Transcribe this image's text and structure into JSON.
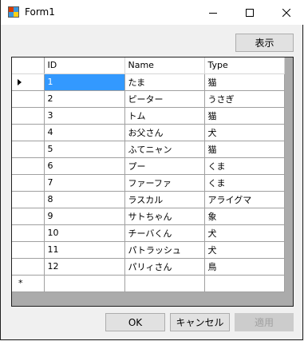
{
  "window": {
    "title": "Form1"
  },
  "toolbar": {
    "show_label": "表示"
  },
  "grid": {
    "columns": [
      "ID",
      "Name",
      "Type"
    ],
    "rows": [
      {
        "id": "1",
        "name": "たま",
        "type": "猫"
      },
      {
        "id": "2",
        "name": "ピーター",
        "type": "うさぎ"
      },
      {
        "id": "3",
        "name": "トム",
        "type": "猫"
      },
      {
        "id": "4",
        "name": "お父さん",
        "type": "犬"
      },
      {
        "id": "5",
        "name": "ふてニャン",
        "type": "猫"
      },
      {
        "id": "6",
        "name": "プー",
        "type": "くま"
      },
      {
        "id": "7",
        "name": "ファーファ",
        "type": "くま"
      },
      {
        "id": "8",
        "name": "ラスカル",
        "type": "アライグマ"
      },
      {
        "id": "9",
        "name": "サトちゃん",
        "type": "象"
      },
      {
        "id": "10",
        "name": "チーバくん",
        "type": "犬"
      },
      {
        "id": "11",
        "name": "パトラッシュ",
        "type": "犬"
      },
      {
        "id": "12",
        "name": "パリィさん",
        "type": "鳥"
      }
    ],
    "new_row_marker": "*"
  },
  "footer": {
    "ok_label": "OK",
    "cancel_label": "キャンセル",
    "apply_label": "適用"
  },
  "colors": {
    "selection": "#3399ff",
    "grid_background": "#ababab",
    "window_background": "#f0f0f0"
  },
  "icons": {
    "app": "form-app-icon",
    "minimize": "minimize-icon",
    "maximize": "maximize-icon",
    "close": "close-icon",
    "current_row": "row-indicator-arrow-icon"
  }
}
